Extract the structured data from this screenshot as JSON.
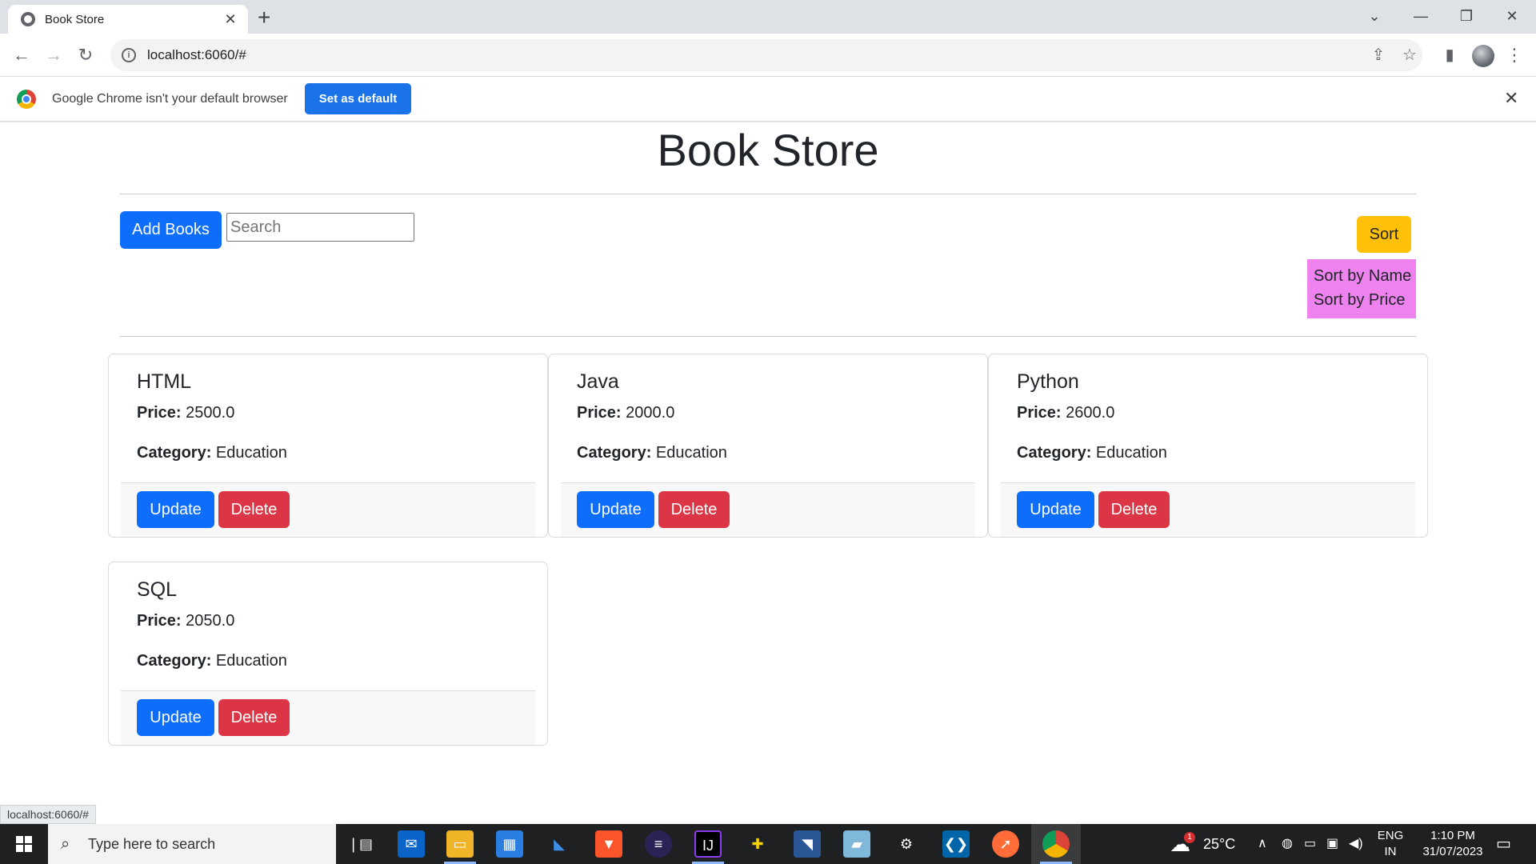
{
  "browser": {
    "tab_title": "Book Store",
    "tab_close": "✕",
    "new_tab": "+",
    "url": "localhost:6060/#",
    "window_controls": {
      "dropdown": "⌄",
      "minimize": "—",
      "restore": "❐",
      "close": "✕"
    }
  },
  "infobar": {
    "message": "Google Chrome isn't your default browser",
    "button_label": "Set as default",
    "close": "✕"
  },
  "page": {
    "title": "Book Store",
    "add_books_label": "Add Books",
    "search_placeholder": "Search",
    "sort_label": "Sort",
    "sort_options": [
      "Sort by Name",
      "Sort by Price"
    ],
    "price_label": "Price:",
    "category_label": "Category:",
    "update_label": "Update",
    "delete_label": "Delete",
    "books": [
      {
        "name": "HTML",
        "price": "2500.0",
        "category": "Education"
      },
      {
        "name": "Java",
        "price": "2000.0",
        "category": "Education"
      },
      {
        "name": "Python",
        "price": "2600.0",
        "category": "Education"
      },
      {
        "name": "SQL",
        "price": "2050.0",
        "category": "Education"
      }
    ]
  },
  "status_url": "localhost:6060/#",
  "taskbar": {
    "search_placeholder": "Type here to search",
    "weather": "25°C",
    "weather_badge": "1",
    "language_top": "ENG",
    "language_bottom": "IN",
    "time": "1:10 PM",
    "date": "31/07/2023"
  },
  "colors": {
    "primary": "#0d6efd",
    "danger": "#dc3545",
    "warning": "#ffc107",
    "sort_menu": "#ee82ee",
    "chrome_blue": "#1a73e8"
  }
}
